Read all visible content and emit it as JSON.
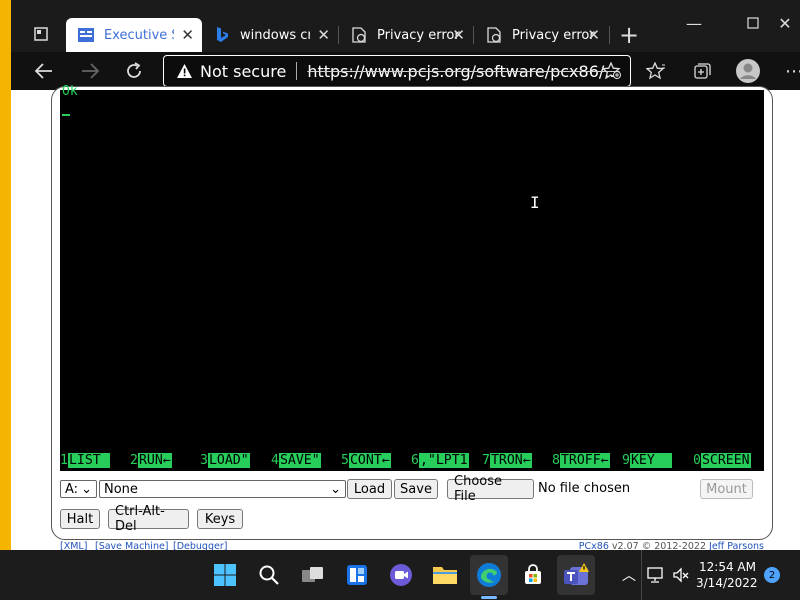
{
  "browser": {
    "tabs": [
      {
        "label": "Executive Sui",
        "icon": "app-icon",
        "active": true
      },
      {
        "label": "windows cra",
        "icon": "bing-icon",
        "active": false
      },
      {
        "label": "Privacy error",
        "icon": "page-error-icon",
        "active": false
      },
      {
        "label": "Privacy error",
        "icon": "page-error-icon",
        "active": false
      }
    ],
    "new_tab": "+",
    "security_label": "Not secure",
    "url": "https://www.pcjs.org/software/pcx86/...",
    "accent": "#f5b400"
  },
  "emulator": {
    "screen_text": "Ok",
    "function_keys": [
      {
        "num": "1",
        "label": "LIST "
      },
      {
        "num": "2",
        "label": "RUN←"
      },
      {
        "num": "3",
        "label": "LOAD\""
      },
      {
        "num": "4",
        "label": "SAVE\""
      },
      {
        "num": "5",
        "label": "CONT←"
      },
      {
        "num": "6",
        "label": ",\"LPT1"
      },
      {
        "num": "7",
        "label": "TRON←"
      },
      {
        "num": "8",
        "label": "TROFF←"
      },
      {
        "num": "9",
        "label": "KEY  "
      },
      {
        "num": "0",
        "label": "SCREEN"
      }
    ],
    "screen_color": "#27ce5b",
    "drive_select": "A:",
    "disk_select": "None",
    "load_button": "Load",
    "save_button": "Save",
    "choose_file_button": "Choose File",
    "file_status": "No file chosen",
    "mount_button": "Mount",
    "halt_button": "Halt",
    "cad_button": "Ctrl-Alt-Del",
    "keys_button": "Keys"
  },
  "footer": {
    "xml_link": "[XML]",
    "save_machine_link": "[Save Machine]",
    "debugger_link": "[Debugger]",
    "product_link": "PCx86",
    "version_text": " v2.07 © 2012-2022 ",
    "author_link": "Jeff Parsons"
  },
  "taskbar": {
    "time": "12:54 AM",
    "date": "3/14/2022",
    "notifications": "2"
  }
}
